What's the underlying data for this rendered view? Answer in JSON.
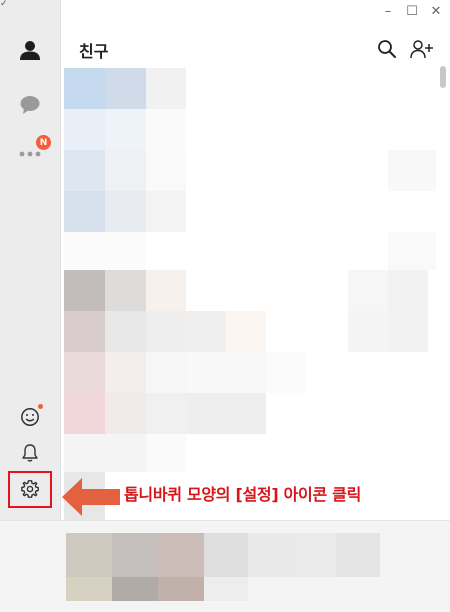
{
  "window": {
    "controls": {
      "minimize": "–",
      "maximize": "☐",
      "close": "✕"
    }
  },
  "header": {
    "title": "친구"
  },
  "sidebar": {
    "corner_glyph": "✓",
    "items": [
      {
        "name": "friends",
        "icon": "person-icon"
      },
      {
        "name": "chats",
        "icon": "chat-bubble-icon"
      },
      {
        "name": "more",
        "icon": "more-dots-icon",
        "badge": "N"
      }
    ],
    "bottom_items": [
      {
        "name": "emoticon",
        "icon": "smiley-icon"
      },
      {
        "name": "notifications",
        "icon": "bell-icon"
      },
      {
        "name": "settings",
        "icon": "gear-icon"
      }
    ]
  },
  "annotation": {
    "text": "톱니바퀴 모양의 [설정] 아이콘 클릭",
    "color": "#d8151a"
  },
  "colors": {
    "badge": "#f25f3a",
    "sidebar_bg": "#ececec",
    "highlight": "#e3151c",
    "arrow": "#e4613f"
  }
}
